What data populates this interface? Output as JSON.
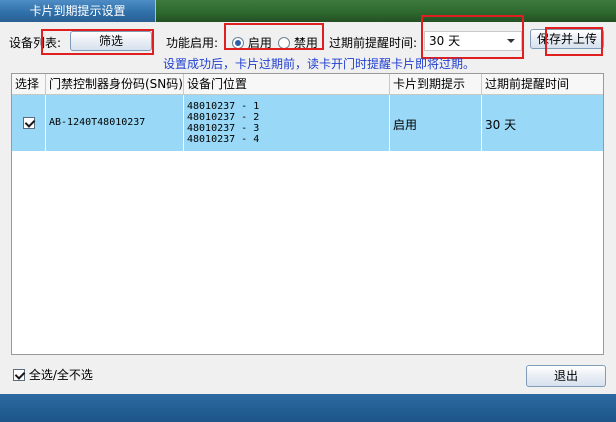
{
  "window": {
    "title": "卡片到期提示设置"
  },
  "toolbar": {
    "device_list_label": "设备列表:",
    "filter_button": "筛选",
    "feature_enable_label": "功能启用:",
    "radio_enable": "启用",
    "radio_disable": "禁用",
    "remind_time_label": "过期前提醒时间:",
    "remind_time_value": "30 天",
    "save_upload_button": "保存并上传"
  },
  "hint": "设置成功后，卡片过期前，读卡开门时提醒卡片即将过期。",
  "table": {
    "columns": [
      "选择",
      "门禁控制器身份码(SN码)",
      "设备门位置",
      "卡片到期提示",
      "过期前提醒时间"
    ],
    "rows": [
      {
        "checked": true,
        "sn": "AB-1240T48010237",
        "doors": [
          "48010237 - 1",
          "48010237 - 2",
          "48010237 - 3",
          "48010237 - 4"
        ],
        "expiry_prompt": "启用",
        "remind_time": "30 天"
      }
    ]
  },
  "footer": {
    "select_all_label": "全选/全不选",
    "exit_button": "退出"
  }
}
